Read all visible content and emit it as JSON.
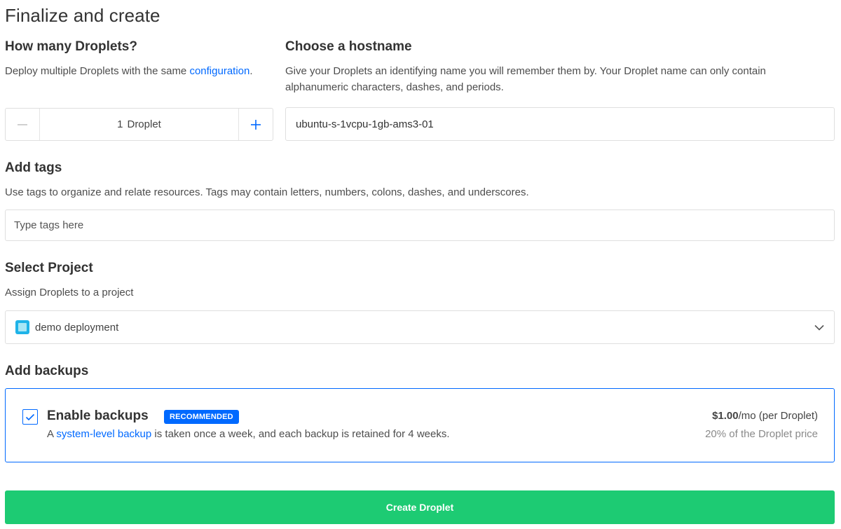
{
  "page_title": "Finalize and create",
  "droplets": {
    "title": "How many Droplets?",
    "desc_prefix": "Deploy multiple Droplets with the same ",
    "desc_link": "configuration",
    "desc_suffix": ".",
    "count": "1",
    "unit": "Droplet"
  },
  "hostname": {
    "title": "Choose a hostname",
    "desc": "Give your Droplets an identifying name you will remember them by. Your Droplet name can only contain alphanumeric characters, dashes, and periods.",
    "value": "ubuntu-s-1vcpu-1gb-ams3-01"
  },
  "tags": {
    "title": "Add tags",
    "desc": "Use tags to organize and relate resources. Tags may contain letters, numbers, colons, dashes, and underscores.",
    "placeholder": "Type tags here"
  },
  "project": {
    "title": "Select Project",
    "desc": "Assign Droplets to a project",
    "selected": "demo deployment"
  },
  "backups": {
    "title": "Add backups",
    "label": "Enable backups",
    "badge": "RECOMMENDED",
    "checked": true,
    "desc_prefix": "A ",
    "desc_link": "system-level backup",
    "desc_suffix": " is taken once a week, and each backup is retained for 4 weeks.",
    "price": "$1.00",
    "price_suffix": "/mo (per Droplet)",
    "price_note": "20% of the Droplet price"
  },
  "create_button": "Create Droplet",
  "colors": {
    "accent": "#0069ff",
    "create_button": "#1dcb73"
  }
}
